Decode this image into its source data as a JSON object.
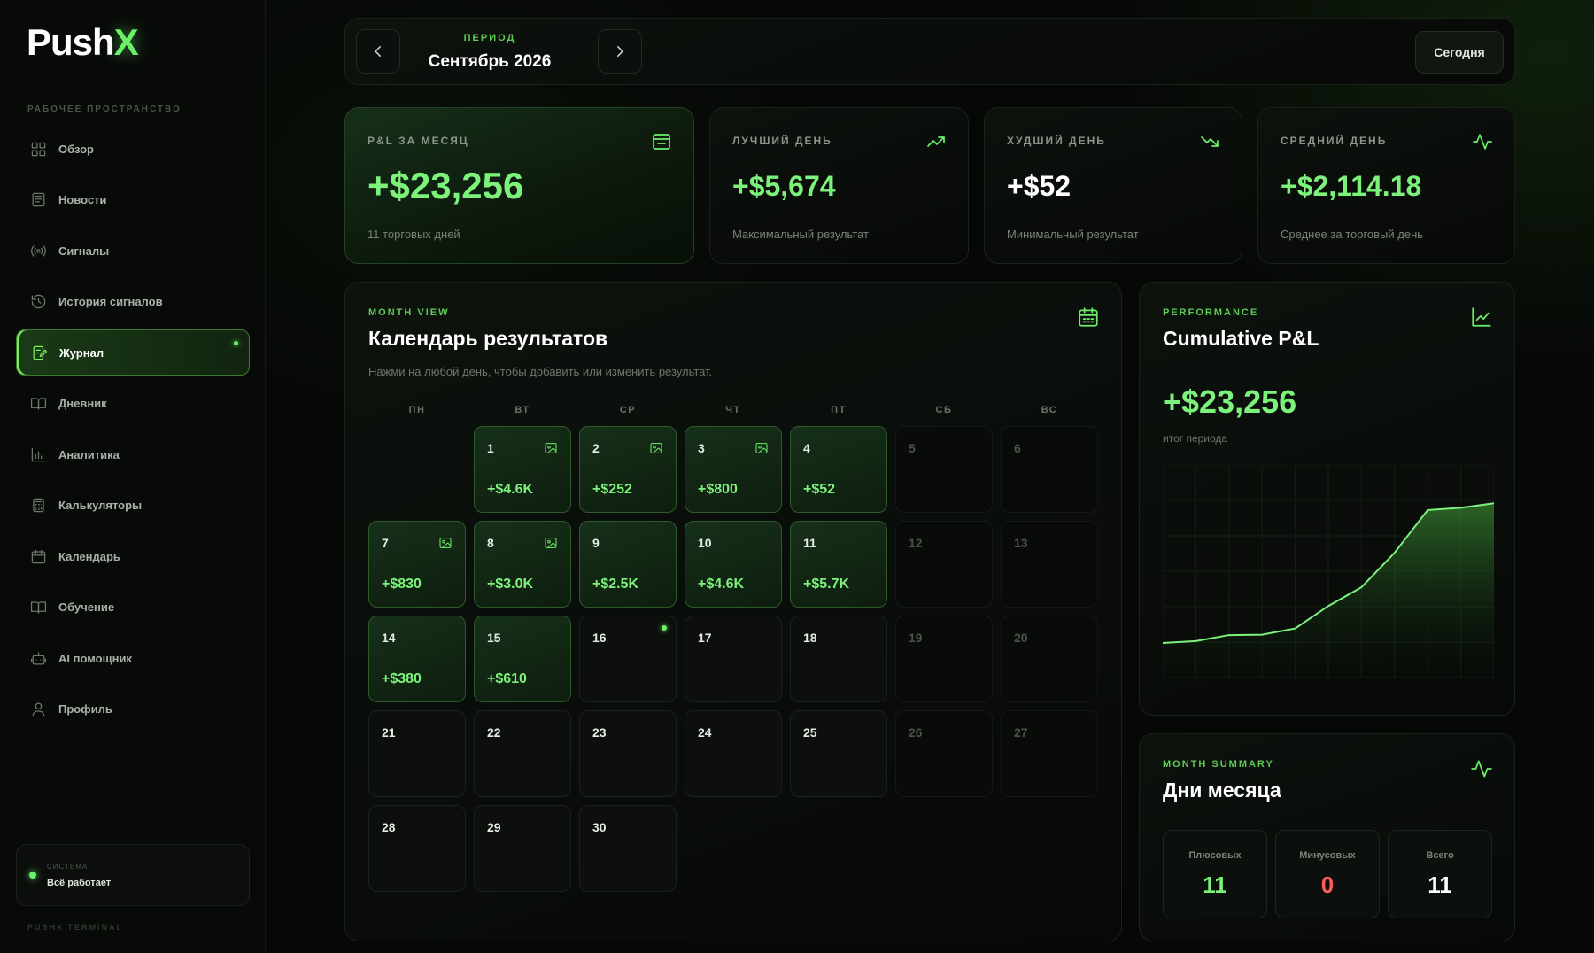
{
  "brand": {
    "name_main": "Push",
    "name_accent": "X"
  },
  "sidebar": {
    "section_label": "РАБОЧЕЕ ПРОСТРАНСТВО",
    "items": [
      {
        "label": "Обзор",
        "icon": "grid-icon"
      },
      {
        "label": "Новости",
        "icon": "newspaper-icon"
      },
      {
        "label": "Сигналы",
        "icon": "broadcast-icon"
      },
      {
        "label": "История сигналов",
        "icon": "history-icon"
      },
      {
        "label": "Журнал",
        "icon": "journal-edit-icon",
        "active": true
      },
      {
        "label": "Дневник",
        "icon": "book-open-icon"
      },
      {
        "label": "Аналитика",
        "icon": "bar-chart-icon"
      },
      {
        "label": "Калькуляторы",
        "icon": "calculator-icon"
      },
      {
        "label": "Календарь",
        "icon": "calendar-icon"
      },
      {
        "label": "Обучение",
        "icon": "book-icon"
      },
      {
        "label": "AI помощник",
        "icon": "bot-icon"
      },
      {
        "label": "Профиль",
        "icon": "user-icon"
      }
    ],
    "system": {
      "label": "СИСТЕМА",
      "status": "Всё работает"
    },
    "footer": "PUSHX TERMINAL"
  },
  "period": {
    "label": "ПЕРИОД",
    "value": "Сентябрь 2026",
    "today_button": "Сегодня"
  },
  "stats": {
    "month": {
      "label": "P&L ЗА МЕСЯЦ",
      "value": "+$23,256",
      "sub": "11 торговых дней",
      "icon": "wallet-icon"
    },
    "best": {
      "label": "ЛУЧШИЙ ДЕНЬ",
      "value": "+$5,674",
      "sub": "Максимальный результат",
      "icon": "trending-up-icon"
    },
    "worst": {
      "label": "ХУДШИЙ ДЕНЬ",
      "value": "+$52",
      "sub": "Минимальный результат",
      "icon": "trending-down-icon"
    },
    "avg": {
      "label": "СРЕДНИЙ ДЕНЬ",
      "value": "+$2,114.18",
      "sub": "Среднее за торговый день",
      "icon": "activity-icon"
    }
  },
  "calendar": {
    "tag": "MONTH VIEW",
    "title": "Календарь результатов",
    "subtitle": "Нажми на любой день, чтобы добавить или изменить результат.",
    "weekdays": [
      "ПН",
      "ВТ",
      "СР",
      "ЧТ",
      "ПТ",
      "СБ",
      "ВС"
    ],
    "start_offset": 1,
    "days": [
      {
        "d": "1",
        "pnl": "+$4.6K",
        "img": true
      },
      {
        "d": "2",
        "pnl": "+$252",
        "img": true
      },
      {
        "d": "3",
        "pnl": "+$800",
        "img": true
      },
      {
        "d": "4",
        "pnl": "+$52",
        "img": false
      },
      {
        "d": "5",
        "pnl": "",
        "img": false
      },
      {
        "d": "6",
        "pnl": "",
        "img": false
      },
      {
        "d": "7",
        "pnl": "+$830",
        "img": true
      },
      {
        "d": "8",
        "pnl": "+$3.0K",
        "img": true
      },
      {
        "d": "9",
        "pnl": "+$2.5K",
        "img": false
      },
      {
        "d": "10",
        "pnl": "+$4.6K",
        "img": false
      },
      {
        "d": "11",
        "pnl": "+$5.7K",
        "img": false
      },
      {
        "d": "12",
        "pnl": "",
        "img": false
      },
      {
        "d": "13",
        "pnl": "",
        "img": false
      },
      {
        "d": "14",
        "pnl": "+$380",
        "img": false
      },
      {
        "d": "15",
        "pnl": "+$610",
        "img": false
      },
      {
        "d": "16",
        "pnl": "",
        "img": false,
        "today": true
      },
      {
        "d": "17",
        "pnl": "",
        "img": false
      },
      {
        "d": "18",
        "pnl": "",
        "img": false
      },
      {
        "d": "19",
        "pnl": "",
        "img": false
      },
      {
        "d": "20",
        "pnl": "",
        "img": false
      },
      {
        "d": "21",
        "pnl": "",
        "img": false
      },
      {
        "d": "22",
        "pnl": "",
        "img": false
      },
      {
        "d": "23",
        "pnl": "",
        "img": false
      },
      {
        "d": "24",
        "pnl": "",
        "img": false
      },
      {
        "d": "25",
        "pnl": "",
        "img": false
      },
      {
        "d": "26",
        "pnl": "",
        "img": false
      },
      {
        "d": "27",
        "pnl": "",
        "img": false
      },
      {
        "d": "28",
        "pnl": "",
        "img": false
      },
      {
        "d": "29",
        "pnl": "",
        "img": false
      },
      {
        "d": "30",
        "pnl": "",
        "img": false
      }
    ]
  },
  "performance": {
    "tag": "PERFORMANCE",
    "title": "Cumulative P&L",
    "value": "+$23,256",
    "sub": "итог периода",
    "line_color": "#7cf27a"
  },
  "chart_data": {
    "type": "area",
    "title": "Cumulative P&L",
    "x": [
      "1",
      "2",
      "3",
      "4",
      "7",
      "8",
      "9",
      "10",
      "11",
      "14",
      "15"
    ],
    "series": [
      {
        "values": [
          4612,
          4864,
          5664,
          5716,
          6546,
          9546,
          12046,
          16646,
          22346,
          22646,
          23256
        ]
      }
    ],
    "grid": true
  },
  "summary": {
    "tag": "MONTH SUMMARY",
    "title": "Дни месяца",
    "boxes": [
      {
        "label": "Плюсовых",
        "value": "11",
        "color": "#7cf27a"
      },
      {
        "label": "Минусовых",
        "value": "0",
        "color": "#ff5a5a"
      },
      {
        "label": "Всего",
        "value": "11",
        "color": "#ffffff"
      }
    ]
  }
}
